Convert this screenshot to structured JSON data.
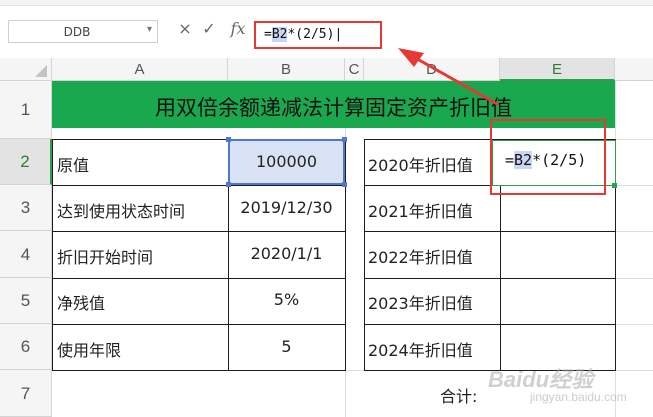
{
  "formula_bar": {
    "name_box": "DDB",
    "name_box_arrow": "▾",
    "cancel_glyph": "×",
    "confirm_glyph": "✓",
    "fx_label": "fx",
    "formula_eq": "=",
    "formula_ref": "B2",
    "formula_rest": "*(2/5)"
  },
  "columns": [
    "A",
    "B",
    "C",
    "D",
    "E"
  ],
  "rows": [
    "1",
    "2",
    "3",
    "4",
    "5",
    "6",
    "7"
  ],
  "sheet": {
    "title": "用双倍余额递减法计算固定资产折旧值",
    "labels": [
      "原值",
      "达到使用状态时间",
      "折旧开始时间",
      "净残值",
      "使用年限"
    ],
    "values": [
      "100000",
      "2019/12/30",
      "2020/1/1",
      "5%",
      "5"
    ],
    "years": [
      "2020年折旧值",
      "2021年折旧值",
      "2022年折旧值",
      "2023年折旧值",
      "2024年折旧值"
    ],
    "total_label": "合计:",
    "e2_formula": {
      "eq": "=",
      "ref": "B2",
      "rest": "*(2/5)"
    }
  },
  "watermark": {
    "text": "Baidu经验",
    "sub": "jingyan.baidu.com"
  },
  "colors": {
    "title_banner": "#19a84e",
    "selection": "#4e77cf",
    "annotation": "#e53935",
    "active_header": "#2e9e4a"
  }
}
